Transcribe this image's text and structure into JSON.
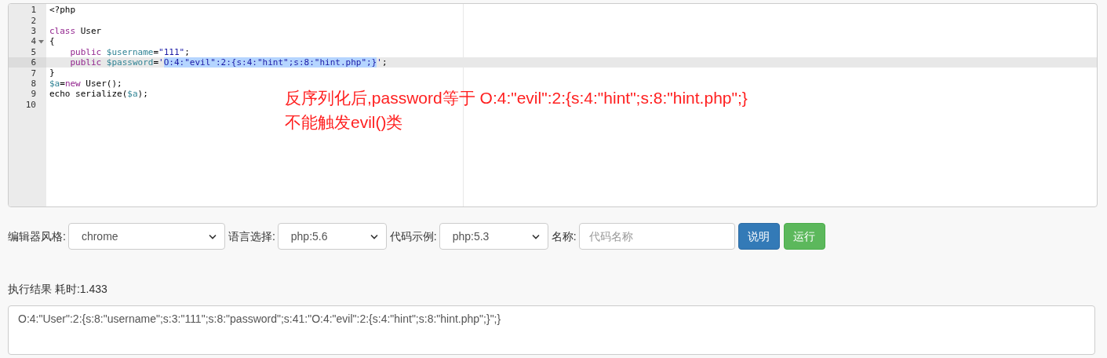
{
  "editor": {
    "lines": [
      {
        "number": "1",
        "active": false,
        "foldable": false,
        "tokens": [
          {
            "kind": "plain",
            "text": "<?php"
          }
        ]
      },
      {
        "number": "2",
        "active": false,
        "foldable": false
      },
      {
        "number": "3",
        "active": false,
        "foldable": false,
        "tokens": [
          {
            "kind": "keyword",
            "text": "class"
          },
          {
            "kind": "plain",
            "text": " User"
          }
        ]
      },
      {
        "number": "4",
        "active": false,
        "foldable": true,
        "tokens": [
          {
            "kind": "plain",
            "text": "{"
          }
        ]
      },
      {
        "number": "5",
        "active": false,
        "foldable": false,
        "tokens": [
          {
            "kind": "keyword",
            "text": "    public "
          },
          {
            "kind": "variable",
            "text": "$username"
          },
          {
            "kind": "plain",
            "text": "="
          },
          {
            "kind": "string",
            "text": "\"111\""
          },
          {
            "kind": "plain",
            "text": ";"
          }
        ]
      },
      {
        "number": "6",
        "active": true,
        "foldable": false,
        "tokens": [
          {
            "kind": "keyword",
            "text": "    public "
          },
          {
            "kind": "variable",
            "text": "$password"
          },
          {
            "kind": "plain",
            "text": "="
          },
          {
            "kind": "string",
            "text": "'"
          },
          {
            "kind": "selected",
            "text": "O:4:\"evil\":2:{s:4:\"hint\";s:8:\"hint.php\";}"
          },
          {
            "kind": "string",
            "text": "'"
          },
          {
            "kind": "plain",
            "text": ";"
          }
        ]
      },
      {
        "number": "7",
        "active": false,
        "foldable": false,
        "tokens": [
          {
            "kind": "plain",
            "text": "}"
          }
        ]
      },
      {
        "number": "8",
        "active": false,
        "foldable": false,
        "tokens": [
          {
            "kind": "variable",
            "text": "$a"
          },
          {
            "kind": "plain",
            "text": "="
          },
          {
            "kind": "keyword",
            "text": "new"
          },
          {
            "kind": "plain",
            "text": " User();"
          }
        ]
      },
      {
        "number": "9",
        "active": false,
        "foldable": false,
        "tokens": [
          {
            "kind": "plain",
            "text": "echo serialize("
          },
          {
            "kind": "variable",
            "text": "$a"
          },
          {
            "kind": "plain",
            "text": ");"
          }
        ]
      },
      {
        "number": "10",
        "active": false,
        "foldable": false
      }
    ],
    "annotation": [
      "反序列化后,password等于 O:4:\"evil\":2:{s:4:\"hint\";s:8:\"hint.php\";}",
      "不能触发evil()类"
    ]
  },
  "toolbar": {
    "fields": [
      {
        "kind": "select",
        "label": "编辑器风格:",
        "value": "chrome"
      },
      {
        "kind": "select",
        "label": "语言选择:",
        "value": "php:5.6"
      },
      {
        "kind": "select",
        "label": "代码示例:",
        "value": "php:5.3"
      },
      {
        "kind": "input",
        "label": "名称:",
        "placeholder": "代码名称"
      }
    ],
    "buttons": [
      {
        "kind": "primary",
        "label": "说明"
      },
      {
        "kind": "success",
        "label": "运行"
      }
    ]
  },
  "result": {
    "label": "执行结果 耗时:1.433",
    "output": "O:4:\"User\":2:{s:8:\"username\";s:3:\"111\";s:8:\"password\";s:41:\"O:4:\"evil\":2:{s:4:\"hint\";s:8:\"hint.php\";}\";}"
  }
}
